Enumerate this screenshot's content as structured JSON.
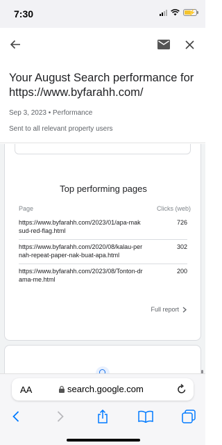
{
  "status_bar": {
    "time": "7:30"
  },
  "toolbar": {
    "back_icon": "arrow-left-icon",
    "mail_icon": "mail-icon",
    "close_icon": "close-icon"
  },
  "email": {
    "title": "Your August Search performance for https://www.byfarahh.com/",
    "date": "Sep 3, 2023",
    "separator": "•",
    "category": "Performance",
    "recipients": "Sent to all relevant property users"
  },
  "top_pages": {
    "title": "Top performing pages",
    "col_page": "Page",
    "col_clicks": "Clicks (web)",
    "rows": [
      {
        "url": "https://www.byfarahh.com/2023/01/apa-maksud-red-flag.html",
        "clicks": "726"
      },
      {
        "url": "https://www.byfarahh.com/2020/08/kalau-pernah-repeat-paper-nak-buat-apa.html",
        "clicks": "302"
      },
      {
        "url": "https://www.byfarahh.com/2023/08/Tonton-drama-me.html",
        "clicks": "200"
      }
    ],
    "full_report": "Full report"
  },
  "browser": {
    "text_size": "AA",
    "url": "search.google.com",
    "nav_icons": [
      "chevron-left-icon",
      "chevron-right-icon",
      "share-icon",
      "bookmarks-icon",
      "tabs-icon"
    ]
  },
  "colors": {
    "accent": "#1a73e8",
    "ios_blue": "#007aff",
    "battery": "#f4c430"
  }
}
